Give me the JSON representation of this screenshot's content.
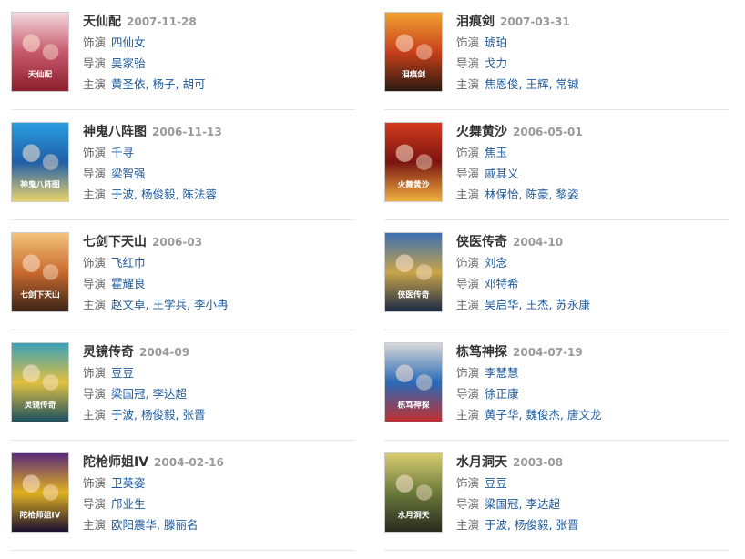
{
  "labels": {
    "actor": "饰演",
    "director": "导演",
    "starring": "主演"
  },
  "items": [
    {
      "title": "天仙配",
      "date": "2007-11-28",
      "role": "四仙女",
      "director": [
        "吴家骀"
      ],
      "stars": [
        "黄圣依",
        "杨子",
        "胡可"
      ],
      "poster_text": "天仙配",
      "colors": [
        "#f2d7dc",
        "#c75a6d",
        "#8c1f2d"
      ]
    },
    {
      "title": "泪痕剑",
      "date": "2007-03-31",
      "role": "琥珀",
      "director": [
        "戈力"
      ],
      "stars": [
        "焦恩俊",
        "王辉",
        "常铖"
      ],
      "poster_text": "泪痕剑",
      "colors": [
        "#f0a030",
        "#c8401a",
        "#2b1a10"
      ]
    },
    {
      "title": "神鬼八阵图",
      "date": "2006-11-13",
      "role": "千寻",
      "director": [
        "梁智强"
      ],
      "stars": [
        "于波",
        "杨俊毅",
        "陈法蓉"
      ],
      "poster_text": "神鬼八阵图",
      "colors": [
        "#2a9de0",
        "#1f5fa8",
        "#e9d36a"
      ]
    },
    {
      "title": "火舞黄沙",
      "date": "2006-05-01",
      "role": "焦玉",
      "director": [
        "戚其义"
      ],
      "stars": [
        "林保怡",
        "陈豪",
        "黎姿"
      ],
      "poster_text": "火舞黄沙",
      "colors": [
        "#d23a1e",
        "#7a1410",
        "#f0b040"
      ]
    },
    {
      "title": "七剑下天山",
      "date": "2006-03",
      "role": "飞红巾",
      "director": [
        "霍耀良"
      ],
      "stars": [
        "赵文卓",
        "王学兵",
        "李小冉"
      ],
      "poster_text": "七剑下天山",
      "colors": [
        "#f3c27a",
        "#c96a2e",
        "#3a2418"
      ]
    },
    {
      "title": "侠医传奇",
      "date": "2004-10",
      "role": "刘念",
      "director": [
        "邓特希"
      ],
      "stars": [
        "吴启华",
        "王杰",
        "苏永康"
      ],
      "poster_text": "侠医传奇",
      "colors": [
        "#3b6fb0",
        "#c9a44a",
        "#1a2a44"
      ]
    },
    {
      "title": "灵镜传奇",
      "date": "2004-09",
      "role": "豆豆",
      "director": [
        "梁国冠",
        "李达超"
      ],
      "stars": [
        "于波",
        "杨俊毅",
        "张晋"
      ],
      "poster_text": "灵镜传奇",
      "colors": [
        "#3aa0b8",
        "#e0c040",
        "#1c5060"
      ]
    },
    {
      "title": "栋笃神探",
      "date": "2004-07-19",
      "role": "李慧慧",
      "director": [
        "徐正康"
      ],
      "stars": [
        "黄子华",
        "魏俊杰",
        "唐文龙"
      ],
      "poster_text": "栋笃神探",
      "colors": [
        "#d8d8d8",
        "#2a6ab8",
        "#c03030"
      ]
    },
    {
      "title": "陀枪师姐IV",
      "date": "2004-02-16",
      "role": "卫英姿",
      "director": [
        "邝业生"
      ],
      "stars": [
        "欧阳震华",
        "滕丽名"
      ],
      "poster_text": "陀枪师姐IV",
      "colors": [
        "#5a2a7a",
        "#e0b020",
        "#1a1030"
      ]
    },
    {
      "title": "水月洞天",
      "date": "2003-08",
      "role": "豆豆",
      "director": [
        "梁国冠",
        "李达超"
      ],
      "stars": [
        "于波",
        "杨俊毅",
        "张晋"
      ],
      "poster_text": "水月洞天",
      "colors": [
        "#d8cc70",
        "#6a7a3a",
        "#2a2a20"
      ]
    }
  ]
}
